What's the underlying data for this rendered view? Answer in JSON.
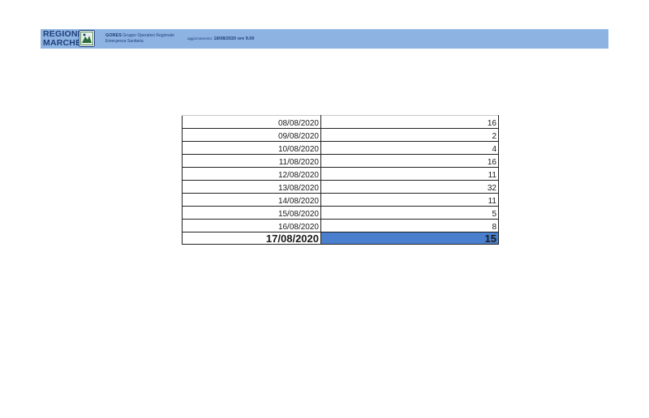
{
  "header": {
    "logo": {
      "line1": "REGIONE",
      "line2": "MARCHE"
    },
    "org_name": "GORES",
    "org_desc_line1": "Gruppo Operativo Regionale",
    "org_desc_line2": "Emergenza Sanitaria",
    "update_label": "aggiornamento:",
    "update_value": "18/08/2020 ore 9.00"
  },
  "table": {
    "rows": [
      {
        "date": "08/08/2020",
        "value": "16"
      },
      {
        "date": "09/08/2020",
        "value": "2"
      },
      {
        "date": "10/08/2020",
        "value": "4"
      },
      {
        "date": "11/08/2020",
        "value": "16"
      },
      {
        "date": "12/08/2020",
        "value": "11"
      },
      {
        "date": "13/08/2020",
        "value": "32"
      },
      {
        "date": "14/08/2020",
        "value": "11"
      },
      {
        "date": "15/08/2020",
        "value": "5"
      },
      {
        "date": "16/08/2020",
        "value": "8"
      }
    ],
    "last_row": {
      "date": "17/08/2020",
      "value": "15"
    },
    "highlight_color": "#4a7fce"
  },
  "colors": {
    "banner": "#8db3e2",
    "brand_text": "#1f3f7a"
  }
}
